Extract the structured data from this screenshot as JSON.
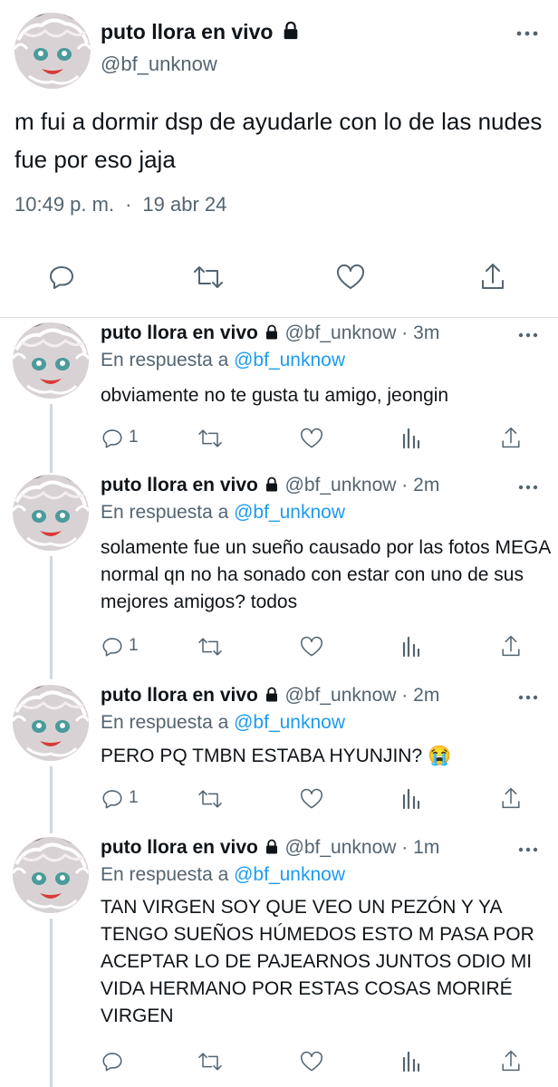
{
  "main_tweet": {
    "name": "puto llora en vivo",
    "handle": "@bf_unknow",
    "text": "m fui a dormir dsp de ayudarle con lo de las nudes fue por eso jaja",
    "time": "10:49 p. m.",
    "separator": "·",
    "date": "19 abr 24"
  },
  "replies": [
    {
      "name": "puto llora en vivo",
      "handle": "@bf_unknow",
      "dot": "·",
      "time": "3m",
      "reply_prefix": "En respuesta a",
      "reply_to": "@bf_unknow",
      "text": "obviamente no te gusta tu amigo, jeongin",
      "reply_count": "1"
    },
    {
      "name": "puto llora en vivo",
      "handle": "@bf_unknow",
      "dot": "·",
      "time": "2m",
      "reply_prefix": "En respuesta a",
      "reply_to": "@bf_unknow",
      "text": "solamente fue un sueño causado por las fotos MEGA normal qn no ha sonado con estar con uno de sus mejores amigos? todos",
      "reply_count": "1"
    },
    {
      "name": "puto llora en vivo",
      "handle": "@bf_unknow",
      "dot": "·",
      "time": "2m",
      "reply_prefix": "En respuesta a",
      "reply_to": "@bf_unknow",
      "text": "PERO PQ TMBN ESTABA HYUNJIN? 😭",
      "reply_count": "1"
    },
    {
      "name": "puto llora en vivo",
      "handle": "@bf_unknow",
      "dot": "·",
      "time": "1m",
      "reply_prefix": "En respuesta a",
      "reply_to": "@bf_unknow",
      "text": "TAN VIRGEN SOY QUE VEO UN PEZÓN Y YA TENGO SUEÑOS HÚMEDOS ESTO M PASA POR ACEPTAR LO DE PAJEARNOS JUNTOS ODIO MI VIDA HERMANO POR ESTAS COSAS MORIRÉ VIRGEN",
      "reply_count": ""
    }
  ],
  "icons": {
    "lock": "lock-icon",
    "more": "more-icon",
    "reply": "reply-icon",
    "retweet": "retweet-icon",
    "like": "like-icon",
    "views": "views-icon",
    "share": "share-icon"
  },
  "colors": {
    "text": "#0f1419",
    "secondary": "#536471",
    "link": "#1d9bf0",
    "divider": "#dadfe3"
  }
}
